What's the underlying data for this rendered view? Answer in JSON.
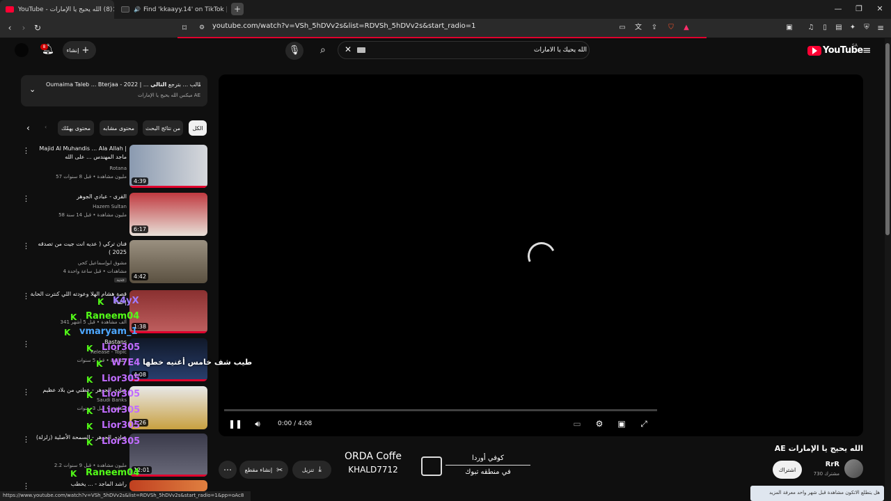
{
  "browser": {
    "tabs": [
      {
        "label": "(8) الله يحيج يا الإمارات - YouTube",
        "active": true,
        "fav_color": "#ff0033"
      },
      {
        "label": "Find 'kkaayy.14' on TikTok | TikTok",
        "active": false,
        "fav_color": "#333333"
      }
    ],
    "new_tab": "+",
    "url": "youtube.com/watch?v=VSh_5hDVv2s&list=RDVSh_5hDVv2s&start_radio=1",
    "status_url": "https://www.youtube.com/watch?v=VSh_5hDVv2s&list=RDVSh_5hDVv2s&start_radio=1&pp=oAc8"
  },
  "youtube": {
    "logo": "YouTube",
    "region": "SA",
    "create_label": "إنشاء",
    "notif_count": "8",
    "search_value": "الله يحيك يا الامارات",
    "now_playing": {
      "label": "التالي:",
      "title": "Oumaima Taleb ... Bterjaa - 2022 | ... طالب ... بترجع",
      "playlist": "ميكس الله يحيج يا الإمارات AE"
    },
    "chips": [
      "الكل",
      "من نتائج البحث",
      "محتوى مشابه",
      "محتوى يهمّك"
    ],
    "videos": [
      {
        "title": "Majid Al Muhandis ... Ala Allah | ماجد المهندس ... على الله",
        "channel": "Rotana",
        "meta": "57 مليون مشاهدة • قبل 8 سنوات",
        "duration": "4:39",
        "thumb": "#7a8aa0",
        "progress": 1
      },
      {
        "title": "القرى - عبادي الجوهر",
        "channel": "Hazem Sultan",
        "meta": "58 مليون مشاهدة • قبل 14 سنة",
        "duration": "6:17",
        "thumb": "#b0303a",
        "progress": 1
      },
      {
        "title": "فنان تركي ( عديه انت جيت من تصدقه 2025 )",
        "channel": "مشوق ابوإسماعيل كحي",
        "meta": "4 مشاهدات • قبل ساعة واحدة",
        "duration": "4:42",
        "thumb": "#8a8070",
        "progress": 0,
        "badge": "جديد"
      },
      {
        "title": "قصة هشام الهلا وعودته اللي كنترت الحابة | لقاء",
        "channel": "",
        "meta": "341 ألف مشاهدة • قبل 5 أشهر",
        "duration": "1:38",
        "thumb": "#6a2a2a",
        "progress": 1
      },
      {
        "title": "Bastans",
        "channel": "Release - Topic",
        "meta": "مشاهدة • قبل 5 سنوات",
        "duration": "4:08",
        "thumb": "#1a2a4a",
        "progress": 1
      },
      {
        "title": "عبادي الجوهر - عطني من بلاد عظيم",
        "channel": "Saudi Banks",
        "meta": "مشاهدة • قبل 3 سنوات",
        "duration": "2:26",
        "thumb": "#c8a040",
        "progress": 0
      },
      {
        "title": "عبادي الجوهر - السمحة الأصلية (زلزلة)",
        "channel": "",
        "meta": "2.2 مليون مشاهدة • قبل 9 سنوات",
        "duration": "12:01",
        "thumb": "#4a4a5a",
        "progress": 1
      },
      {
        "title": "راشد الماجد - ... يخطب",
        "channel": "",
        "meta": "",
        "duration": "",
        "thumb": "#c04020",
        "progress": 0
      }
    ],
    "player": {
      "time": "0:00 / 4:08"
    },
    "video_title": "الله يحيج يا الإمارات AE",
    "channel": {
      "name": "RrR",
      "subs": "730 مشترك"
    },
    "subscribe": "اشتراك",
    "actions": [
      "تنزيل",
      "إنشاء مقطع"
    ],
    "toast": "هل يتطلع الاتكون مشاهدة قبل شهر واحد معرفة المزيد"
  },
  "overlay": {
    "caption": "طيب شف خامس أغنيه خطها",
    "coffee": {
      "name": "ORDA Coffe",
      "user": "KHALD7712",
      "ar1": "كوفي أوردا",
      "ar2": "في منطقه تبوك"
    },
    "chat": [
      {
        "name": "K4yX",
        "color": "#a07cff"
      },
      {
        "name": "Raneem04",
        "color": "#53fc18"
      },
      {
        "name": "vmaryam_1",
        "color": "#4ea8ff"
      },
      {
        "name": "Lior305",
        "color": "#c06cff"
      },
      {
        "name": "W7E4",
        "color": "#c06cff"
      },
      {
        "name": "Lior305",
        "color": "#c06cff"
      },
      {
        "name": "Lior305",
        "color": "#c06cff"
      },
      {
        "name": "Lior305",
        "color": "#c06cff"
      },
      {
        "name": "Lior305",
        "color": "#c06cff"
      },
      {
        "name": "Lior305",
        "color": "#c06cff"
      },
      {
        "name": "Raneem04",
        "color": "#53fc18"
      }
    ]
  }
}
